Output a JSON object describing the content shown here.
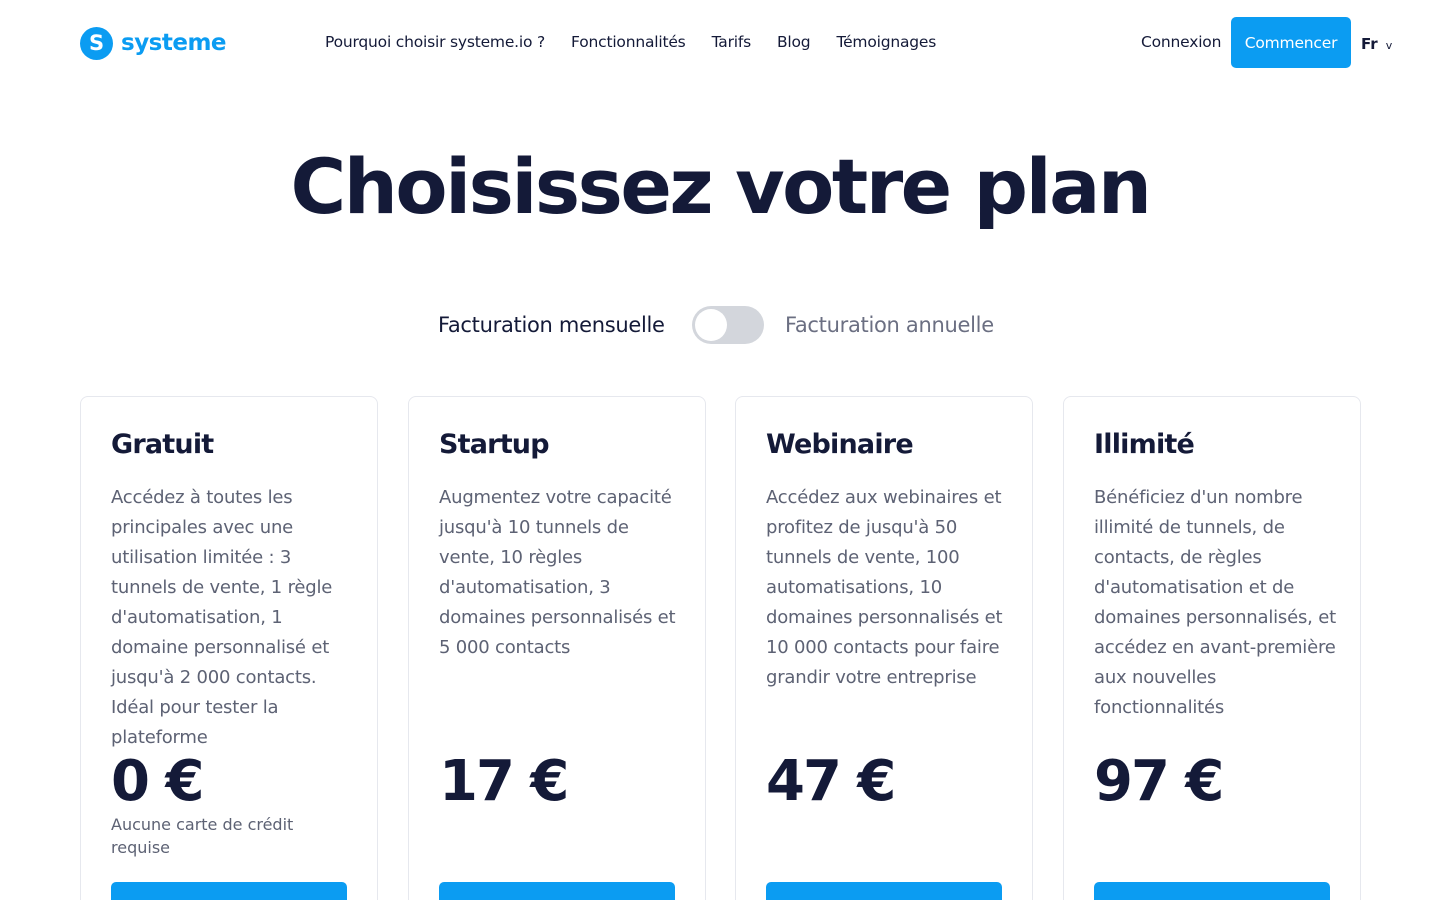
{
  "brand": {
    "logo_letter": "S",
    "name": "systeme",
    "color": "#0b9cf2"
  },
  "nav": {
    "items": [
      "Pourquoi choisir systeme.io ?",
      "Fonctionnalités",
      "Tarifs",
      "Blog",
      "Témoignages"
    ],
    "login": "Connexion",
    "cta": "Commencer",
    "language": "Fr",
    "language_chevron": "v"
  },
  "hero": {
    "title": "Choisissez votre plan"
  },
  "billing": {
    "monthly_label": "Facturation mensuelle",
    "annual_label": "Facturation annuelle",
    "annual_selected": false
  },
  "plans": [
    {
      "name": "Gratuit",
      "description": "Accédez à toutes les principales avec une utilisation limitée : 3 tunnels de vente, 1 règle d'automatisation, 1 domaine personnalisé et jusqu'à 2 000 contacts. Idéal pour tester la plateforme",
      "price": "0 €",
      "note": "Aucune carte de crédit requise"
    },
    {
      "name": "Startup",
      "description": "Augmentez votre capacité jusqu'à 10 tunnels de vente, 10 règles d'automatisation, 3 domaines personnalisés et 5 000 contacts",
      "price": "17 €"
    },
    {
      "name": "Webinaire",
      "description": "Accédez aux webinaires et profitez de jusqu'à 50 tunnels de vente, 100 automatisations, 10 domaines personnalisés et 10 000 contacts pour faire grandir votre entreprise",
      "price": "47 €"
    },
    {
      "name": "Illimité",
      "description": "Bénéficiez d'un nombre illimité de tunnels, de contacts, de règles d'automatisation et de domaines personnalisés, et accédez en avant-première aux nouvelles fonctionnalités",
      "price": "97 €"
    }
  ]
}
